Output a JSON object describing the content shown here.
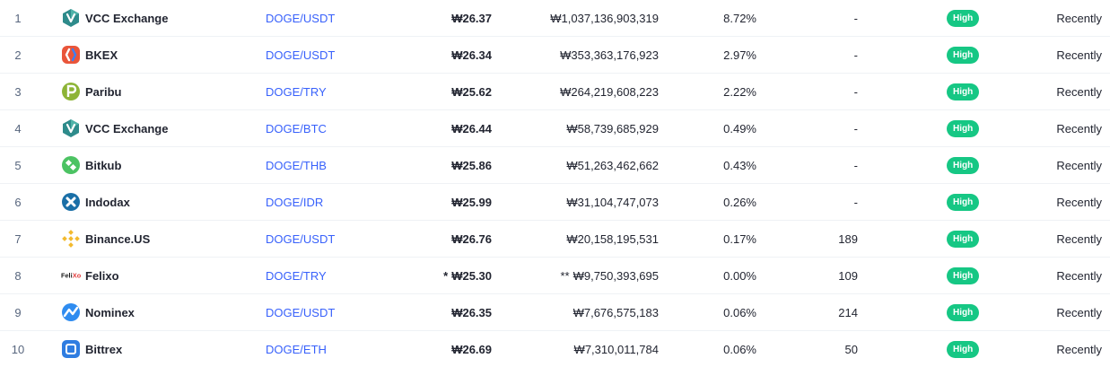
{
  "market_table": {
    "rows": [
      {
        "rank": "1",
        "exchange": "VCC Exchange",
        "logo_icon": "vcc-exchange-icon",
        "pair": "DOGE/USDT",
        "price": "₩26.37",
        "volume": "₩1,037,136,903,319",
        "volume_pct": "8.72%",
        "liquidity": "-",
        "confidence": "High",
        "updated": "Recently",
        "price_prefix": "",
        "volume_prefix": ""
      },
      {
        "rank": "2",
        "exchange": "BKEX",
        "logo_icon": "bkex-icon",
        "pair": "DOGE/USDT",
        "price": "₩26.34",
        "volume": "₩353,363,176,923",
        "volume_pct": "2.97%",
        "liquidity": "-",
        "confidence": "High",
        "updated": "Recently",
        "price_prefix": "",
        "volume_prefix": ""
      },
      {
        "rank": "3",
        "exchange": "Paribu",
        "logo_icon": "paribu-icon",
        "pair": "DOGE/TRY",
        "price": "₩25.62",
        "volume": "₩264,219,608,223",
        "volume_pct": "2.22%",
        "liquidity": "-",
        "confidence": "High",
        "updated": "Recently",
        "price_prefix": "",
        "volume_prefix": ""
      },
      {
        "rank": "4",
        "exchange": "VCC Exchange",
        "logo_icon": "vcc-exchange-icon",
        "pair": "DOGE/BTC",
        "price": "₩26.44",
        "volume": "₩58,739,685,929",
        "volume_pct": "0.49%",
        "liquidity": "-",
        "confidence": "High",
        "updated": "Recently",
        "price_prefix": "",
        "volume_prefix": ""
      },
      {
        "rank": "5",
        "exchange": "Bitkub",
        "logo_icon": "bitkub-icon",
        "pair": "DOGE/THB",
        "price": "₩25.86",
        "volume": "₩51,263,462,662",
        "volume_pct": "0.43%",
        "liquidity": "-",
        "confidence": "High",
        "updated": "Recently",
        "price_prefix": "",
        "volume_prefix": ""
      },
      {
        "rank": "6",
        "exchange": "Indodax",
        "logo_icon": "indodax-icon",
        "pair": "DOGE/IDR",
        "price": "₩25.99",
        "volume": "₩31,104,747,073",
        "volume_pct": "0.26%",
        "liquidity": "-",
        "confidence": "High",
        "updated": "Recently",
        "price_prefix": "",
        "volume_prefix": ""
      },
      {
        "rank": "7",
        "exchange": "Binance.US",
        "logo_icon": "binance-icon",
        "pair": "DOGE/USDT",
        "price": "₩26.76",
        "volume": "₩20,158,195,531",
        "volume_pct": "0.17%",
        "liquidity": "189",
        "confidence": "High",
        "updated": "Recently",
        "price_prefix": "",
        "volume_prefix": ""
      },
      {
        "rank": "8",
        "exchange": "Felixo",
        "logo_icon": "felixo-icon",
        "logo_text": "FeliXo",
        "pair": "DOGE/TRY",
        "price": "₩25.30",
        "volume": "₩9,750,393,695",
        "volume_pct": "0.00%",
        "liquidity": "109",
        "confidence": "High",
        "updated": "Recently",
        "price_prefix": "*",
        "volume_prefix": "**"
      },
      {
        "rank": "9",
        "exchange": "Nominex",
        "logo_icon": "nominex-icon",
        "pair": "DOGE/USDT",
        "price": "₩26.35",
        "volume": "₩7,676,575,183",
        "volume_pct": "0.06%",
        "liquidity": "214",
        "confidence": "High",
        "updated": "Recently",
        "price_prefix": "",
        "volume_prefix": ""
      },
      {
        "rank": "10",
        "exchange": "Bittrex",
        "logo_icon": "bittrex-icon",
        "pair": "DOGE/ETH",
        "price": "₩26.69",
        "volume": "₩7,310,011,784",
        "volume_pct": "0.06%",
        "liquidity": "50",
        "confidence": "High",
        "updated": "Recently",
        "price_prefix": "",
        "volume_prefix": ""
      }
    ]
  },
  "colors": {
    "link": "#3861fb",
    "confidence_high": "#16c784",
    "text": "#222531",
    "muted": "#58667e",
    "divider": "#eff2f5"
  }
}
